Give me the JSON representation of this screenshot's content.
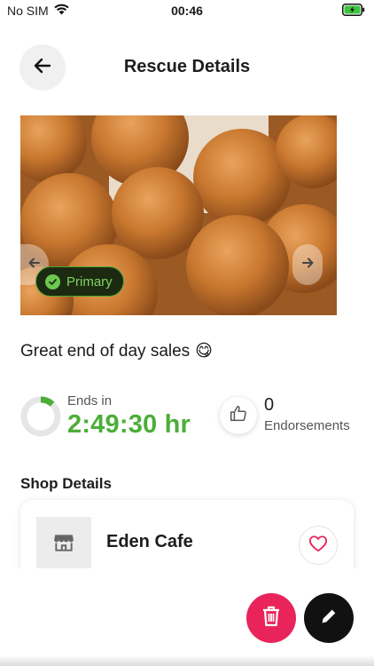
{
  "status": {
    "carrier": "No SIM",
    "time": "00:46"
  },
  "header": {
    "title": "Rescue Details"
  },
  "hero": {
    "badge_label": "Primary"
  },
  "description": {
    "text": "Great end of day sales",
    "emoji": "😋"
  },
  "timer": {
    "label": "Ends in",
    "value": "2:49:30 hr",
    "progress": 0.12
  },
  "endorsements": {
    "count": "0",
    "label": "Endorsements"
  },
  "shop_section": {
    "title": "Shop Details",
    "shop_name": "Eden Cafe"
  },
  "colors": {
    "accent_green": "#4cae39",
    "delete_red": "#e8245a",
    "edit_black": "#111111"
  },
  "icons": {
    "back": "arrow-left-icon",
    "prev": "chevron-left-icon",
    "next": "chevron-right-icon",
    "check": "check-icon",
    "thumb": "thumbs-up-icon",
    "shop": "store-icon",
    "heart": "heart-icon",
    "trash": "trash-icon",
    "pencil": "pencil-icon",
    "wifi": "wifi-icon",
    "battery": "battery-charging-icon"
  }
}
